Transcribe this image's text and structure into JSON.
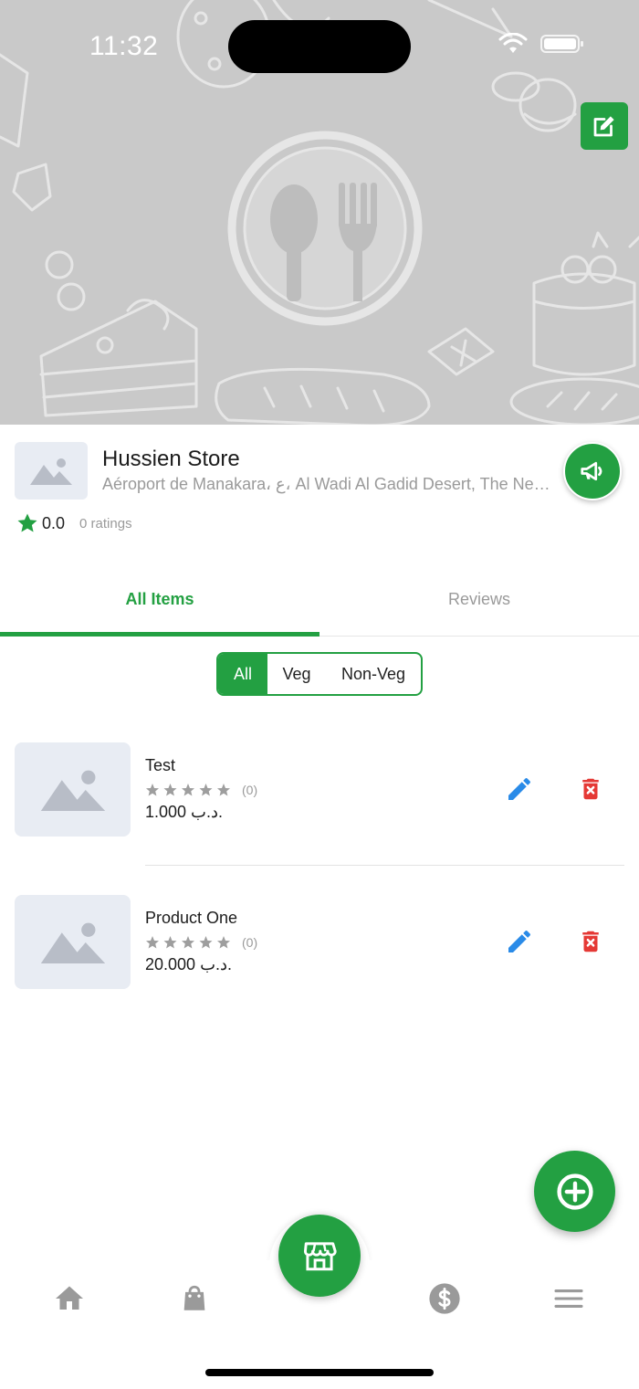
{
  "status_bar": {
    "time": "11:32"
  },
  "cover": {
    "icon": "restaurant-icon"
  },
  "store": {
    "name": "Hussien Store",
    "address": "Aéroport de Manakara، ع، Al Wadi Al Gadid Desert, The New Valley Governorate, Egypt",
    "rating": "0.0",
    "ratings_count": "0 ratings"
  },
  "tabs": [
    {
      "label": "All Items",
      "active": true
    },
    {
      "label": "Reviews",
      "active": false
    }
  ],
  "filter": {
    "options": [
      "All",
      "Veg",
      "Non-Veg"
    ],
    "selected": "All"
  },
  "products": [
    {
      "name": "Test",
      "rating_count": "(0)",
      "price": "1.000 د.ب."
    },
    {
      "name": "Product One",
      "rating_count": "(0)",
      "price": "20.000 د.ب."
    }
  ],
  "bottom_nav": {
    "items": [
      "home-icon",
      "orders-bag-icon",
      "store-icon",
      "wallet-dollar-icon",
      "menu-icon"
    ],
    "active": "store-icon"
  },
  "colors": {
    "brand": "#23a042",
    "edit_blue": "#2a8be8",
    "delete_red": "#e53935"
  }
}
